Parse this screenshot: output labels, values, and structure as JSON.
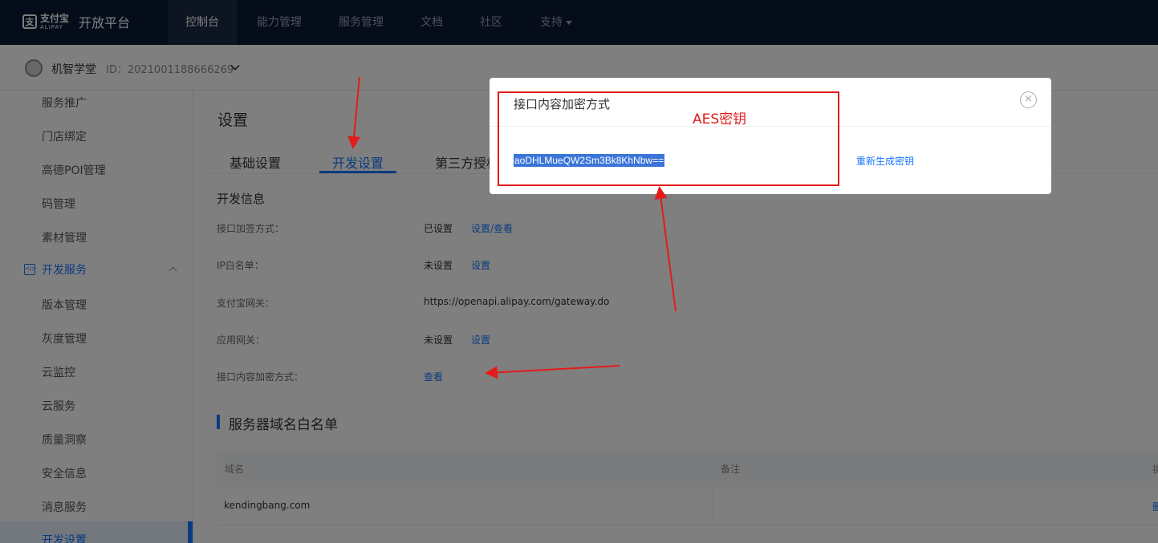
{
  "topnav": {
    "logo_mark": "支",
    "brand_cn": "支付宝",
    "brand_en": "ALIPAY",
    "platform_title": "开放平台",
    "items": [
      {
        "label": "控制台",
        "active": true
      },
      {
        "label": "能力管理"
      },
      {
        "label": "服务管理"
      },
      {
        "label": "文档"
      },
      {
        "label": "社区"
      },
      {
        "label": "支持"
      }
    ]
  },
  "appbar": {
    "app_name": "机智学堂",
    "app_id": "ID：2021001188666269"
  },
  "sidebar": {
    "items_top": [
      "服务推广",
      "门店绑定",
      "高德POI管理",
      "码管理",
      "素材管理"
    ],
    "group_label": "开发服务",
    "items_sub": [
      "版本管理",
      "灰度管理",
      "云监控",
      "云服务",
      "质量洞察",
      "安全信息",
      "消息服务",
      "开发设置"
    ]
  },
  "main": {
    "page_title": "设置",
    "tabs": [
      "基础设置",
      "开发设置",
      "第三方授权"
    ],
    "section_title": "开发信息",
    "rows": [
      {
        "label": "接口加签方式：",
        "value": "已设置",
        "link": "设置/查看"
      },
      {
        "label": "IP白名单：",
        "value": "未设置",
        "link": "设置"
      },
      {
        "label": "支付宝网关：",
        "value": "https://openapi.alipay.com/gateway.do",
        "link": ""
      },
      {
        "label": "应用网关：",
        "value": "未设置",
        "link": "设置"
      },
      {
        "label": "接口内容加密方式：",
        "value": "",
        "link": "查看"
      }
    ],
    "whitelist_title": "服务器域名白名单",
    "table": {
      "headers": [
        "域名",
        "备注",
        "操"
      ],
      "rows": [
        {
          "domain": "kendingbang.com",
          "remark": "",
          "action": "删"
        }
      ]
    }
  },
  "modal": {
    "title": "接口内容加密方式",
    "key_value": "aoDHLMueQW2Sm3Bk8KhNbw==",
    "regen_link": "重新生成密钥",
    "close_glyph": "×"
  },
  "annotation": {
    "label": "AES密钥",
    "color": "#e41b1b"
  },
  "colors": {
    "nav_bg": "#0b1935",
    "accent": "#1677ff",
    "selection": "#3a75d8"
  }
}
